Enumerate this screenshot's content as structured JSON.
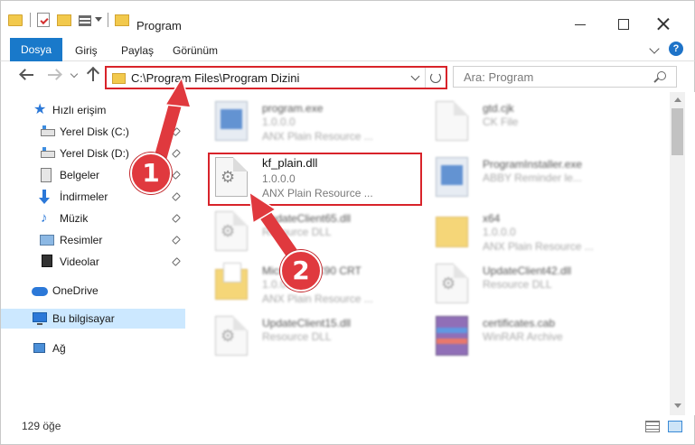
{
  "window": {
    "title": "Program"
  },
  "ribbon": {
    "tabs": [
      "Dosya",
      "Giriş",
      "Paylaş",
      "Görünüm"
    ],
    "help_label": "?"
  },
  "address_bar": {
    "path": "C:\\Program Files\\Program Dizini"
  },
  "search": {
    "placeholder": "Ara: Program"
  },
  "nav_pane": {
    "items": [
      {
        "label": "Hızlı erişim",
        "icon": "star-icon",
        "pinned": false
      },
      {
        "label": "Yerel Disk (C:)",
        "icon": "disk-icon",
        "pinned": true
      },
      {
        "label": "Yerel Disk (D:)",
        "icon": "disk-icon",
        "pinned": true
      },
      {
        "label": "Belgeler",
        "icon": "documents-icon",
        "pinned": true
      },
      {
        "label": "İndirmeler",
        "icon": "downloads-icon",
        "pinned": true
      },
      {
        "label": "Müzik",
        "icon": "music-icon",
        "pinned": true
      },
      {
        "label": "Resimler",
        "icon": "pictures-icon",
        "pinned": true
      },
      {
        "label": "Videolar",
        "icon": "videos-icon",
        "pinned": true
      },
      {
        "label": "OneDrive",
        "icon": "cloud-icon",
        "pinned": false
      },
      {
        "label": "Bu bilgisayar",
        "icon": "computer-icon",
        "pinned": false,
        "selected": true
      },
      {
        "label": "Ağ",
        "icon": "network-icon",
        "pinned": false
      }
    ]
  },
  "files": [
    {
      "name": "program.exe",
      "line1": "1.0.0.0",
      "line2": "ANX Plain Resource ...",
      "icon": "exe-icon",
      "dim": true
    },
    {
      "name": "gtd.cjk",
      "line1": "CK File",
      "line2": "",
      "icon": "document-icon",
      "dim": true
    },
    {
      "name": "kf_plain.dll",
      "line1": "1.0.0.0",
      "line2": "ANX Plain Resource ...",
      "icon": "dll-gear-icon",
      "dim": false
    },
    {
      "name": "ProgramInstaller.exe",
      "line1": "ABBY Reminder le...",
      "line2": "",
      "icon": "exe-icon",
      "dim": true
    },
    {
      "name": "UpdateClient65.dll",
      "line1": "Resource DLL",
      "line2": "",
      "icon": "dll-gear-icon",
      "dim": true
    },
    {
      "name": "x64",
      "line1": "1.0.0.0",
      "line2": "ANX Plain Resource ...",
      "icon": "folder-icon",
      "dim": true
    },
    {
      "name": "Microsoft VC90 CRT",
      "line1": "1.0.0.0",
      "line2": "ANX Plain Resource ...",
      "icon": "folder-icon",
      "dim": true
    },
    {
      "name": "UpdateClient42.dll",
      "line1": "Resource DLL",
      "line2": "",
      "icon": "dll-gear-icon",
      "dim": true
    },
    {
      "name": "UpdateClient15.dll",
      "line1": "Resource DLL",
      "line2": "",
      "icon": "dll-gear-icon",
      "dim": true
    },
    {
      "name": "certificates.cab",
      "line1": "WinRAR Archive",
      "line2": "",
      "icon": "archive-icon",
      "dim": true
    }
  ],
  "annotations": {
    "badge1": "1",
    "badge2": "2",
    "color": "#e0393e"
  },
  "status_bar": {
    "item_count": "129 öğe"
  },
  "colors": {
    "file_tab": "#1979ca",
    "selection": "#cce8ff",
    "highlight_border": "#d8232a"
  }
}
